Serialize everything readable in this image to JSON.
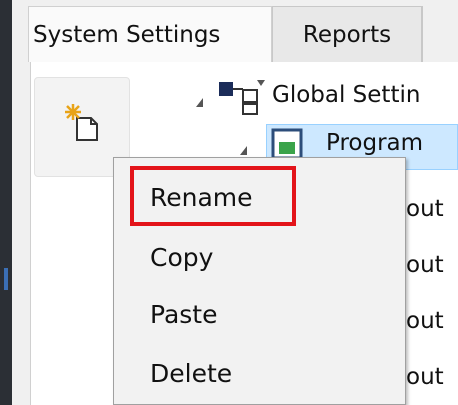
{
  "tabs": [
    {
      "label": "System Settings",
      "active": true
    },
    {
      "label": "Reports",
      "active": false
    }
  ],
  "toolbar": {
    "icon": "new-item-icon"
  },
  "tree": {
    "global_label": "Global Settin",
    "program_label": "Program",
    "child_peek": [
      "out",
      "out",
      "out",
      "out"
    ]
  },
  "context_menu": {
    "items": [
      "Rename",
      "Copy",
      "Paste",
      "Delete"
    ],
    "highlighted": "Rename"
  },
  "colors": {
    "highlight_border": "#e3141a",
    "selection": "#cde8ff"
  }
}
